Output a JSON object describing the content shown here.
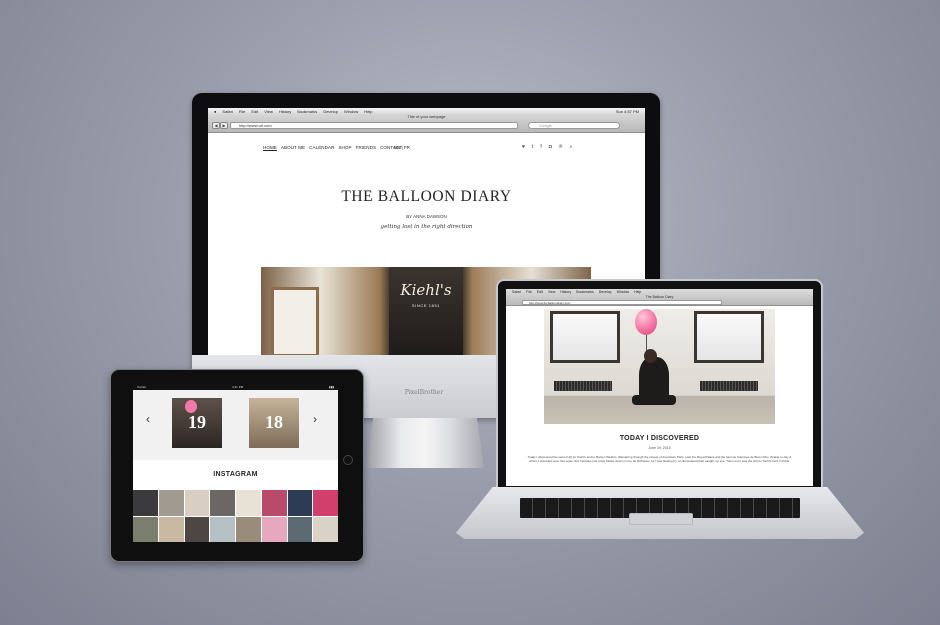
{
  "imac": {
    "brand": "PixelBrother",
    "menubar": {
      "apple": "",
      "items": [
        "Safari",
        "File",
        "Edit",
        "View",
        "History",
        "Bookmarks",
        "Develop",
        "Window",
        "Help"
      ],
      "right": "Sun 4:57 PM"
    },
    "toolbar": {
      "title": "Title of your webpage",
      "url": "http://www.url.com",
      "search_placeholder": "Google",
      "back": "◀",
      "forward": "▶"
    },
    "site": {
      "nav": [
        "HOME",
        "ABOUT ME",
        "CALENDAR",
        "SHOP",
        "FRIENDS",
        "CONTACT"
      ],
      "lang": "EN | FR",
      "social_icons": [
        "heart-icon",
        "twitter-icon",
        "facebook-icon",
        "instagram-icon",
        "pinterest-icon",
        "search-icon"
      ],
      "social_glyphs": [
        "♥",
        "t",
        "f",
        "◘",
        "℗",
        "⌕"
      ],
      "title": "THE BALLOON DIARY",
      "byline": "BY ANNA DAWSON",
      "tagline": "getting lost in the right direction",
      "hero_logo": "Kiehl's",
      "hero_since": "SINCE 1851"
    }
  },
  "laptop": {
    "menubar": [
      "Safari",
      "File",
      "Edit",
      "View",
      "History",
      "Bookmarks",
      "Develop",
      "Window",
      "Help"
    ],
    "title": "The Balloon Diary",
    "url": "http://www.theballoondiary.com",
    "post_title": "TODAY I DISCOVERED",
    "post_date": "June 19, 2015",
    "post_body": "Today I discovered the secret HQ for Kiehl's and le Maison Weldiro. Wandering through the streets of downtown Paris, past the Royal Palace and the famous Colonnes de Buren Rue Vivalde to day & where I stumbled upon this super chic boutique just a few blocks down on rue de Richelieu. As I was floating by, an illuminated heart caught my eye. Turns out it was the HQ for Kiehl's here in Paris."
  },
  "ipad": {
    "status_left": "Carrier",
    "status_center": "4:21 PM",
    "status_right": "▮▮▮",
    "prev": "‹",
    "next": "›",
    "cards": [
      {
        "number": "19"
      },
      {
        "number": "18"
      }
    ],
    "instagram_title": "INSTAGRAM",
    "instagram_colors": [
      "#3b3a3c",
      "#a09a90",
      "#d8cfc2",
      "#6c6764",
      "#e8e1d6",
      "#b84a6b",
      "#2e3b55",
      "#d23f6d",
      "#7a7f6d",
      "#c9b9a3",
      "#4d4643",
      "#b5c1c4",
      "#9a8c7a",
      "#e6a8bf",
      "#5c6a74",
      "#d9d2c7"
    ]
  }
}
